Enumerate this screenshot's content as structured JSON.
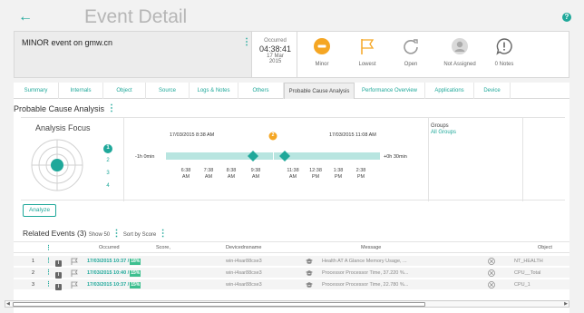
{
  "header": {
    "title": "Event Detail",
    "back_glyph": "←",
    "help_glyph": "?"
  },
  "summary": {
    "event_name": "MINOR event on gmw.cn",
    "occurred_label": "Occurred",
    "occurred_time": "04:38:41",
    "occurred_date": "17 Mar",
    "occurred_year": "2015",
    "stats": [
      {
        "label": "Minor",
        "icon": "minus-circle-icon"
      },
      {
        "label": "Lowest",
        "icon": "flag-icon"
      },
      {
        "label": "Open",
        "icon": "refresh-icon"
      },
      {
        "label": "Not Assigned",
        "icon": "user-icon"
      },
      {
        "label": "0 Notes",
        "icon": "exclamation-bubble-icon"
      }
    ],
    "colors": {
      "minor": "#f5a623",
      "accent": "#1fa89a"
    }
  },
  "tabs": [
    {
      "label": "Summary"
    },
    {
      "label": "Internals"
    },
    {
      "label": "Object"
    },
    {
      "label": "Source"
    },
    {
      "label": "Logs & Notes"
    },
    {
      "label": "Others"
    },
    {
      "label": "Probable Cause Analysis",
      "active": true
    },
    {
      "label": "Performance Overview"
    },
    {
      "label": "Applications"
    },
    {
      "label": "Device"
    }
  ],
  "pca": {
    "title": "Probable Cause Analysis",
    "focus_title": "Analysis Focus",
    "levels": [
      "1",
      "2",
      "3",
      "4"
    ],
    "timeline": {
      "start_date": "17/03/2015 8:38 AM",
      "end_date": "17/03/2015 11:08 AM",
      "left_label": "-1h 0min",
      "right_label": "+0h 30min",
      "marker_count": "2",
      "ticks": [
        {
          "time": "6:38",
          "ampm": "AM"
        },
        {
          "time": "7:38",
          "ampm": "AM"
        },
        {
          "time": "8:38",
          "ampm": "AM"
        },
        {
          "time": "9:38",
          "ampm": "AM"
        },
        {
          "time": "11:38",
          "ampm": "AM"
        },
        {
          "time": "12:38",
          "ampm": "PM"
        },
        {
          "time": "1:38",
          "ampm": "PM"
        },
        {
          "time": "2:38",
          "ampm": "PM"
        }
      ]
    },
    "groups_label": "Groups",
    "groups_value": "All Groups",
    "analyze_label": "Analyze"
  },
  "related": {
    "title": "Related Events (3)",
    "show": "Show 50",
    "sort": "Sort by Score",
    "columns": [
      "Occurred",
      "Score,",
      "Devicednsname",
      "Message",
      "Object"
    ],
    "rows": [
      {
        "num": "1",
        "occurred": "17/03/2015 10:37 /",
        "pct": "18%",
        "device": "win-i4sar88cse3",
        "message": "Health AT A Glance Memory Usage, ...",
        "object": "NT_HEALTH"
      },
      {
        "num": "2",
        "occurred": "17/03/2015 10:40 /",
        "pct": "15%",
        "device": "win-i4sar88cse3",
        "message": "Processor Processor Time, 37.220 %...",
        "object": "CPU__Total"
      },
      {
        "num": "3",
        "occurred": "17/03/2015 10:37 /",
        "pct": "15%",
        "device": "win-i4sar88cse3",
        "message": "Processor Processor Time, 22.780 %...",
        "object": "CPU_1"
      }
    ]
  }
}
